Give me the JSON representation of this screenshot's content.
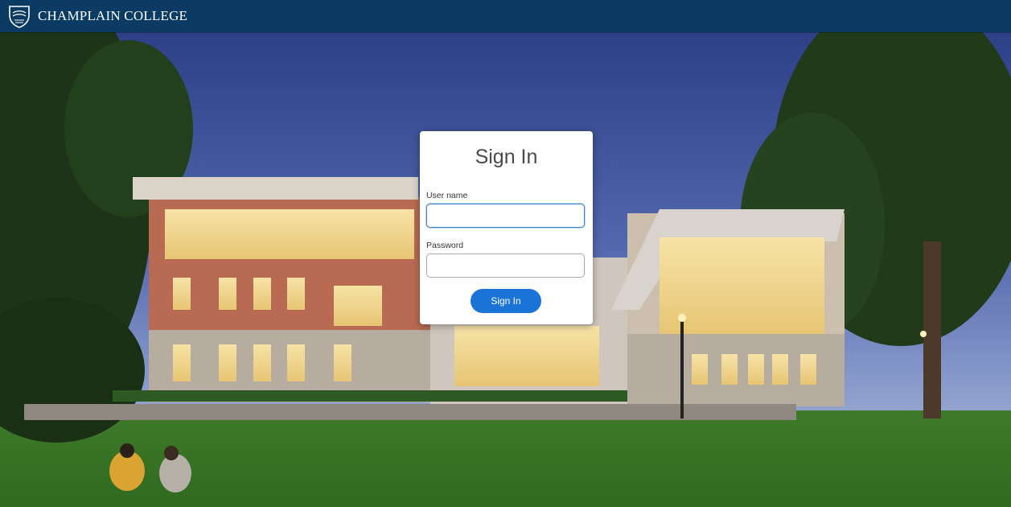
{
  "header": {
    "brand_name": "CHAMPLAIN COLLEGE",
    "logo_icon": "shield-icon",
    "background_color": "#0b3a63"
  },
  "signin": {
    "title": "Sign In",
    "username_label": "User name",
    "username_value": "",
    "password_label": "Password",
    "password_value": "",
    "button_label": "Sign In",
    "button_color": "#1a73d6"
  }
}
